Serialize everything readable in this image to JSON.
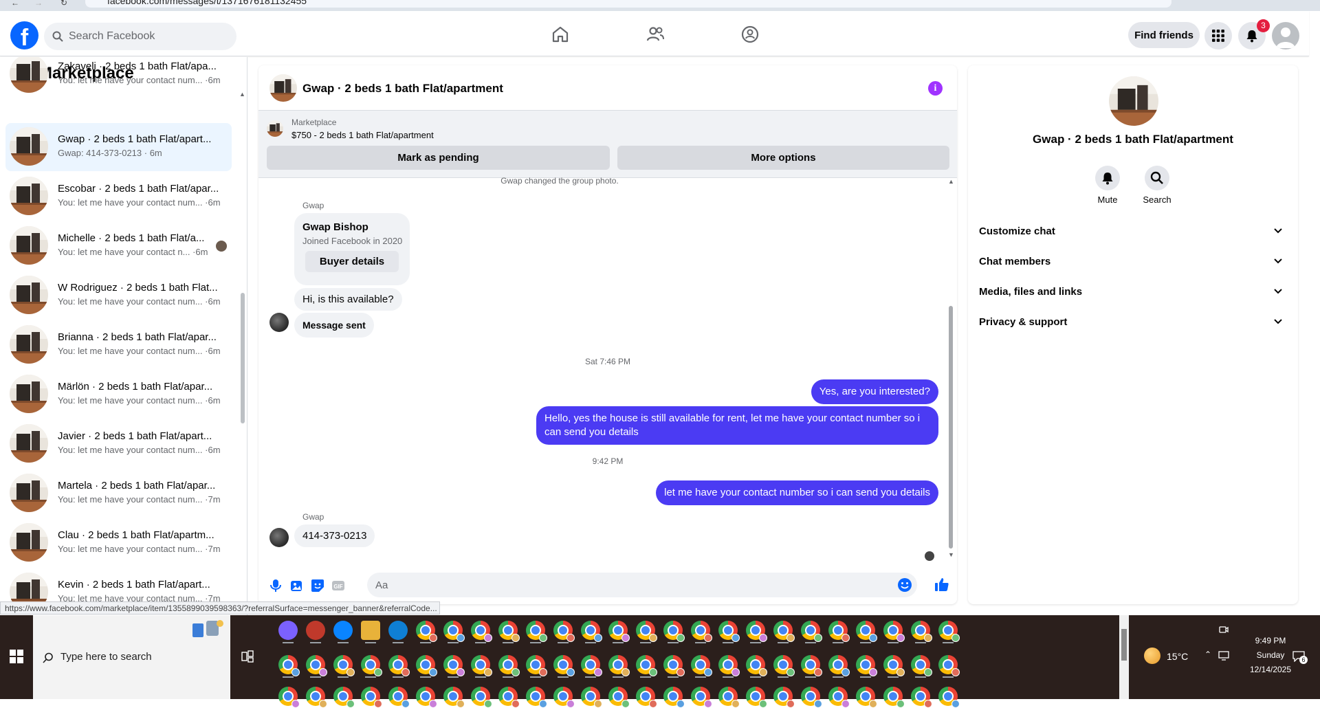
{
  "browser": {
    "url": "facebook.com/messages/t/1371676181132455"
  },
  "topnav": {
    "search_placeholder": "Search Facebook",
    "find_friends": "Find friends",
    "notifications_count": "3"
  },
  "sidebar": {
    "title": "Marketplace",
    "conversations": [
      {
        "name": "Zakaveli · 2 beds 1 bath Flat/apa...",
        "sub": "You: let me have your contact num... ·6m"
      },
      {
        "name": "Gwap · 2 beds 1 bath Flat/apart...",
        "sub": "Gwap: 414-373-0213 · 6m"
      },
      {
        "name": "Escobar · 2 beds 1 bath Flat/apar...",
        "sub": "You: let me have your contact num... ·6m"
      },
      {
        "name": "Michelle · 2 beds 1 bath Flat/a...",
        "sub": "You: let me have your contact n... ·6m"
      },
      {
        "name": "W Rodriguez · 2 beds 1 bath Flat...",
        "sub": "You: let me have your contact num... ·6m"
      },
      {
        "name": "Brianna · 2 beds 1 bath Flat/apar...",
        "sub": "You: let me have your contact num... ·6m"
      },
      {
        "name": "Märlön · 2 beds 1 bath Flat/apar...",
        "sub": "You: let me have your contact num... ·6m"
      },
      {
        "name": "Javier · 2 beds 1 bath Flat/apart...",
        "sub": "You: let me have your contact num... ·6m"
      },
      {
        "name": "Martela · 2 beds 1 bath Flat/apar...",
        "sub": "You: let me have your contact num... ·7m"
      },
      {
        "name": "Clau · 2 beds 1 bath Flat/apartm...",
        "sub": "You: let me have your contact num... ·7m"
      },
      {
        "name": "Kevin · 2 beds 1 bath Flat/apart...",
        "sub": "You: let me have your contact num... ·7m"
      }
    ]
  },
  "conversation": {
    "title": "Gwap · 2 beds 1 bath Flat/apartment",
    "marketplace_label": "Marketplace",
    "listing": "$750 - 2 beds 1 bath Flat/apartment",
    "mark_pending": "Mark as pending",
    "more_options": "More options",
    "system_photo": "Gwap changed the group photo.",
    "sender_name": "Gwap",
    "buyer_card": {
      "name": "Gwap Bishop",
      "joined": "Joined Facebook in 2020",
      "button": "Buyer details"
    },
    "msg_available": "Hi, is this available?",
    "msg_sent": "Message sent",
    "time1": "Sat 7:46 PM",
    "out1": "Yes, are you interested?",
    "out2": "Hello, yes the house is still available for rent, let me have your contact number so i can send you details",
    "time2": "9:42 PM",
    "out3": "let me have your contact number so i can send you details",
    "sender_name2": "Gwap",
    "phone": "414-373-0213",
    "composer_placeholder": "Aa"
  },
  "details": {
    "name": "Gwap · 2 beds 1 bath Flat/apartment",
    "mute": "Mute",
    "search": "Search",
    "sections": [
      "Customize chat",
      "Chat members",
      "Media, files and links",
      "Privacy & support"
    ]
  },
  "status_link": "https://www.facebook.com/marketplace/item/1355899039598363/?referralSurface=messenger_banner&referralCode...",
  "taskbar": {
    "search_placeholder": "Type here to search",
    "weather": "15°C",
    "time": "9:49 PM",
    "day": "Sunday",
    "date": "12/14/2025",
    "notif_count": "6"
  },
  "colors": {
    "fb_blue": "#0866ff",
    "outgoing_bubble": "#4b3bf3",
    "info_purple": "#a033ff",
    "badge_red": "#e41e3f"
  },
  "icons": [
    "home-icon",
    "friends-icon",
    "groups-icon",
    "apps-grid-icon",
    "bell-icon",
    "info-icon",
    "mic-icon",
    "photo-icon",
    "sticker-icon",
    "gif-icon",
    "emoji-icon",
    "like-icon",
    "chevron-down-icon"
  ]
}
